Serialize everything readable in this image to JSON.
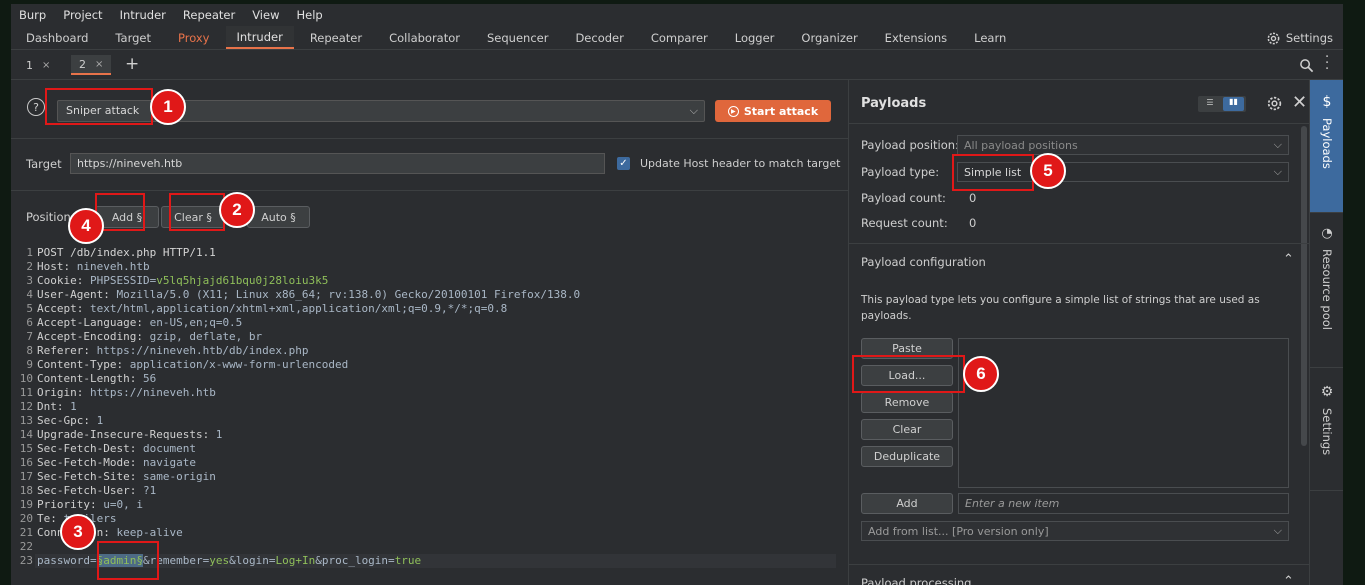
{
  "menu": [
    "Burp",
    "Project",
    "Intruder",
    "Repeater",
    "View",
    "Help"
  ],
  "tabs": [
    {
      "label": "Dashboard"
    },
    {
      "label": "Target"
    },
    {
      "label": "Proxy"
    },
    {
      "label": "Intruder"
    },
    {
      "label": "Repeater"
    },
    {
      "label": "Collaborator"
    },
    {
      "label": "Sequencer"
    },
    {
      "label": "Decoder"
    },
    {
      "label": "Comparer"
    },
    {
      "label": "Logger"
    },
    {
      "label": "Organizer"
    },
    {
      "label": "Extensions"
    },
    {
      "label": "Learn"
    }
  ],
  "settings_label": "Settings",
  "subtabs": [
    {
      "label": "1"
    },
    {
      "label": "2"
    }
  ],
  "attack": {
    "type": "Sniper attack",
    "start_label": "Start attack"
  },
  "target": {
    "label": "Target",
    "value": "https://nineveh.htb",
    "update_host_label": "Update Host header to match target"
  },
  "positions": {
    "label": "Positions",
    "add": "Add §",
    "clear": "Clear §",
    "auto": "Auto §"
  },
  "request": {
    "lines": [
      "POST /db/index.php HTTP/1.1",
      "Host: nineveh.htb",
      "Cookie: PHPSESSID=v5lq5hjajd61bqu0j28loiu3k5",
      "User-Agent: Mozilla/5.0 (X11; Linux x86_64; rv:138.0) Gecko/20100101 Firefox/138.0",
      "Accept: text/html,application/xhtml+xml,application/xml;q=0.9,*/*;q=0.8",
      "Accept-Language: en-US,en;q=0.5",
      "Accept-Encoding: gzip, deflate, br",
      "Referer: https://nineveh.htb/db/index.php",
      "Content-Type: application/x-www-form-urlencoded",
      "Content-Length: 56",
      "Origin: https://nineveh.htb",
      "Dnt: 1",
      "Sec-Gpc: 1",
      "Upgrade-Insecure-Requests: 1",
      "Sec-Fetch-Dest: document",
      "Sec-Fetch-Mode: navigate",
      "Sec-Fetch-Site: same-origin",
      "Sec-Fetch-User: ?1",
      "Priority: u=0, i",
      "Te: trailers",
      "Connection: keep-alive",
      "",
      "password=§admin§&remember=yes&login=Log+In&proc_login=true"
    ]
  },
  "payloads": {
    "title": "Payloads",
    "position_label": "Payload position:",
    "position_value": "All payload positions",
    "type_label": "Payload type:",
    "type_value": "Simple list",
    "count_label": "Payload count:",
    "count_value": "0",
    "request_count_label": "Request count:",
    "request_count_value": "0",
    "config_title": "Payload configuration",
    "config_desc": "This payload type lets you configure a simple list of strings that are used as payloads.",
    "buttons": {
      "paste": "Paste",
      "load": "Load...",
      "remove": "Remove",
      "clear": "Clear",
      "deduplicate": "Deduplicate",
      "add": "Add"
    },
    "new_item_placeholder": "Enter a new item",
    "add_from_list": "Add from list... [Pro version only]",
    "processing_title": "Payload processing"
  },
  "rail": [
    {
      "label": "Payloads"
    },
    {
      "label": "Resource pool"
    },
    {
      "label": "Settings"
    }
  ],
  "annotations": [
    "1",
    "2",
    "3",
    "4",
    "5",
    "6"
  ],
  "colors": {
    "accent": "#e8734a",
    "start": "#e0673c",
    "annotation": "#e01818",
    "selected": "#3d6a9e"
  }
}
